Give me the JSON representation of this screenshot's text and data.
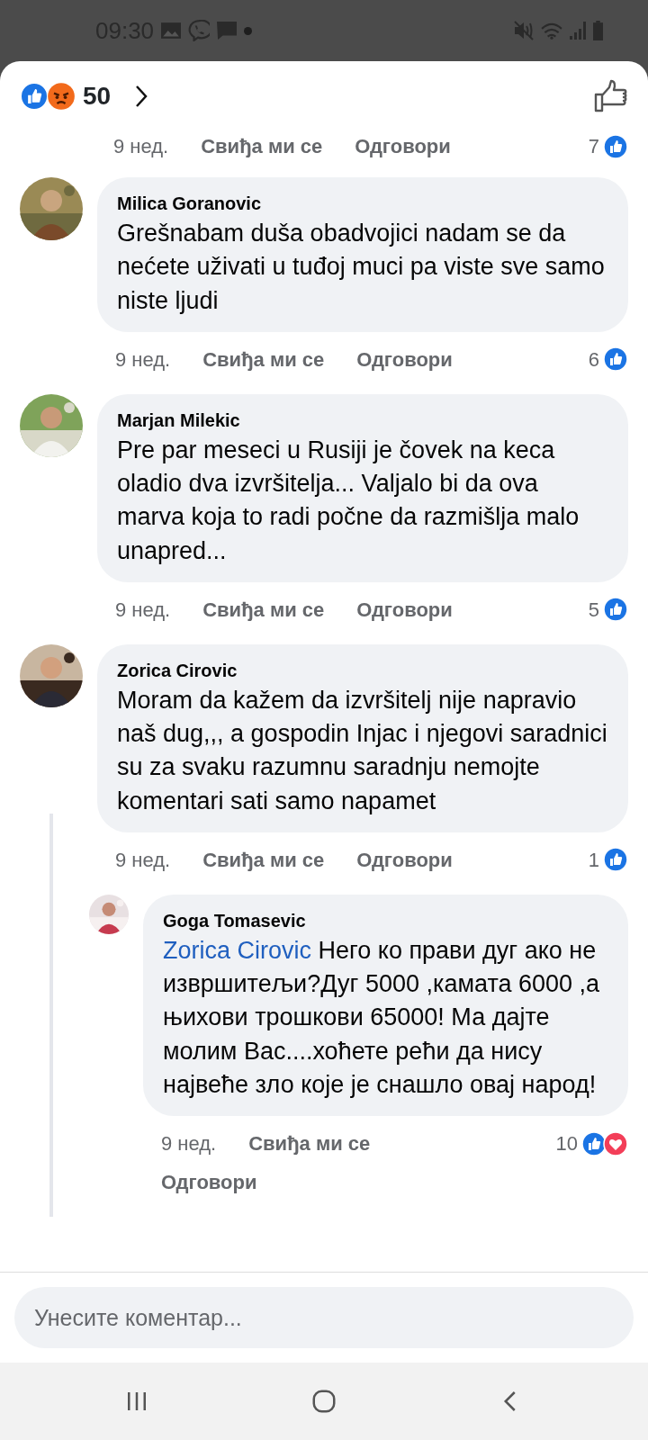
{
  "status_bar": {
    "time": "09:30"
  },
  "header": {
    "reaction_count": "50",
    "reactions": [
      {
        "kind": "like"
      },
      {
        "kind": "angry"
      }
    ]
  },
  "previous_meta": {
    "time": "9 нед.",
    "like": "Свиђа ми се",
    "reply": "Одговори",
    "count": "7",
    "reactions": [
      {
        "kind": "like"
      }
    ]
  },
  "comments": [
    {
      "name": "Milica Goranovic",
      "text": "Grešnabam duša obadvojici nadam se da nećete uživati u tuđoj muci pa viste sve samo niste ljudi",
      "time": "9 нед.",
      "like": "Свиђа ми се",
      "reply": "Одговори",
      "count": "6",
      "reactions": [
        {
          "kind": "like"
        }
      ]
    },
    {
      "name": "Marjan Milekic",
      "text": "Pre par meseci u Rusiji je čovek na keca oladio dva izvršitelja... Valjalo bi da ova marva koja to radi počne da razmišlja malo unapred...",
      "time": "9 нед.",
      "like": "Свиђа ми се",
      "reply": "Одговори",
      "count": "5",
      "reactions": [
        {
          "kind": "like"
        }
      ]
    },
    {
      "name": "Zorica Cirovic",
      "text": "Moram da kažem da izvršitelj nije napravio naš dug,,, a gospodin Injac i njegovi saradnici su za svaku razumnu saradnju nemojte komentari sati samo napamet",
      "time": "9 нед.",
      "like": "Свиђа ми се",
      "reply": "Одговори",
      "count": "1",
      "reactions": [
        {
          "kind": "like"
        }
      ],
      "replies": [
        {
          "name": "Goga Tomasevic",
          "mention": "Zorica Cirovic",
          "text": "Него ко прави дуг ако не извршитељи?Дуг 5000 ,камата 6000 ,а њихови трошкови 65000! Ма дајте молим Вас....хоћете рећи да нису највеће зло које је снашло овај народ!",
          "time": "9 нед.",
          "like": "Свиђа ми се",
          "reply": "Одговори",
          "count": "10",
          "reactions": [
            {
              "kind": "like"
            },
            {
              "kind": "love"
            }
          ]
        }
      ]
    }
  ],
  "comment_input": {
    "placeholder": "Унесите коментар..."
  }
}
